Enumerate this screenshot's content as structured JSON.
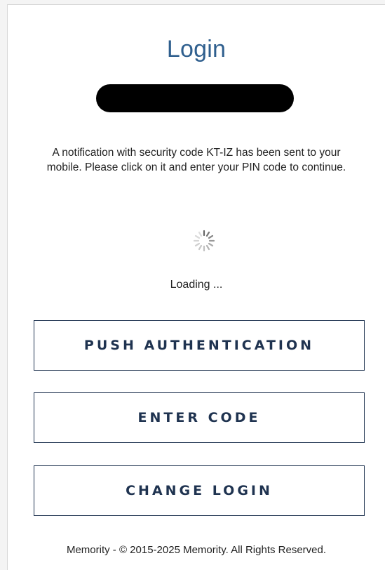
{
  "login": {
    "title": "Login",
    "message": "A notification with security code KT-IZ has been sent to your mobile. Please click on it and enter your PIN code to continue.",
    "loading_text": "Loading ...",
    "buttons": {
      "push_authentication": "PUSH AUTHENTICATION",
      "enter_code": "ENTER CODE",
      "change_login": "CHANGE LOGIN"
    },
    "footer": "Memority - © 2015-2025 Memority. All Rights Reserved."
  },
  "colors": {
    "title": "#2f5f8e",
    "button_border": "#1f3350",
    "button_text": "#1f3350"
  },
  "icons": {
    "spinner": "loading-spinner-icon"
  }
}
